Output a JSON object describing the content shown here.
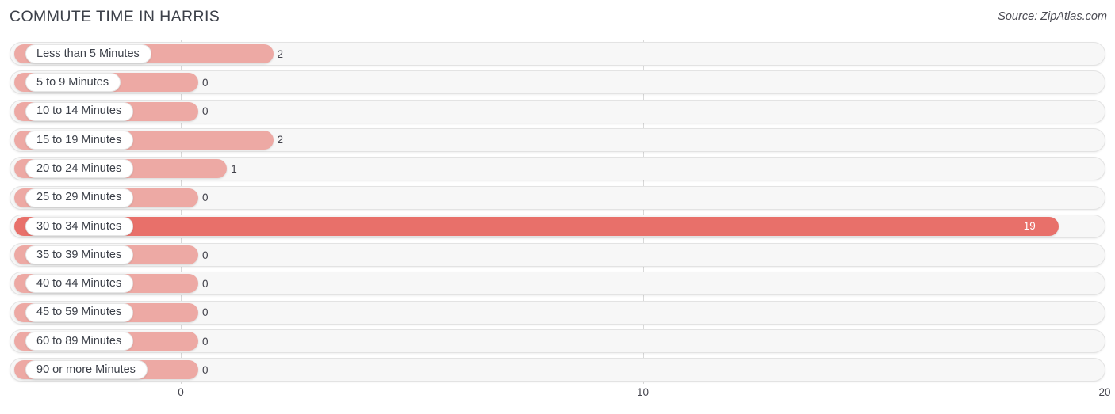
{
  "header": {
    "title": "COMMUTE TIME IN HARRIS",
    "source": "Source: ZipAtlas.com"
  },
  "colors": {
    "bar": "#eda9a4",
    "bar_highlight": "#e8706a",
    "track": "#f7f7f7",
    "track_border": "#e3e3e3",
    "gridline": "#d9d9d9",
    "text": "#3c4049",
    "value_in_bar": "#ffffff"
  },
  "chart_data": {
    "type": "bar",
    "orientation": "horizontal",
    "title": "COMMUTE TIME IN HARRIS",
    "subtitle": "Source: ZipAtlas.com",
    "xlabel": "",
    "ylabel": "",
    "xlim": [
      0,
      20
    ],
    "xticks": [
      0,
      10,
      20
    ],
    "xtick_labels": [
      "0",
      "10",
      "20"
    ],
    "grid": true,
    "legend": false,
    "categories": [
      "Less than 5 Minutes",
      "5 to 9 Minutes",
      "10 to 14 Minutes",
      "15 to 19 Minutes",
      "20 to 24 Minutes",
      "25 to 29 Minutes",
      "30 to 34 Minutes",
      "35 to 39 Minutes",
      "40 to 44 Minutes",
      "45 to 59 Minutes",
      "60 to 89 Minutes",
      "90 or more Minutes"
    ],
    "values": [
      2,
      0,
      0,
      2,
      1,
      0,
      19,
      0,
      0,
      0,
      0,
      0
    ],
    "value_labels": [
      "2",
      "0",
      "0",
      "2",
      "1",
      "0",
      "19",
      "0",
      "0",
      "0",
      "0",
      "0"
    ],
    "highlight_index": 6,
    "rows": [
      {
        "label": "Less than 5 Minutes",
        "value": 2,
        "value_label": "2",
        "highlight": false
      },
      {
        "label": "5 to 9 Minutes",
        "value": 0,
        "value_label": "0",
        "highlight": false
      },
      {
        "label": "10 to 14 Minutes",
        "value": 0,
        "value_label": "0",
        "highlight": false
      },
      {
        "label": "15 to 19 Minutes",
        "value": 2,
        "value_label": "2",
        "highlight": false
      },
      {
        "label": "20 to 24 Minutes",
        "value": 1,
        "value_label": "1",
        "highlight": false
      },
      {
        "label": "25 to 29 Minutes",
        "value": 0,
        "value_label": "0",
        "highlight": false
      },
      {
        "label": "30 to 34 Minutes",
        "value": 19,
        "value_label": "19",
        "highlight": true
      },
      {
        "label": "35 to 39 Minutes",
        "value": 0,
        "value_label": "0",
        "highlight": false
      },
      {
        "label": "40 to 44 Minutes",
        "value": 0,
        "value_label": "0",
        "highlight": false
      },
      {
        "label": "45 to 59 Minutes",
        "value": 0,
        "value_label": "0",
        "highlight": false
      },
      {
        "label": "60 to 89 Minutes",
        "value": 0,
        "value_label": "0",
        "highlight": false
      },
      {
        "label": "90 or more Minutes",
        "value": 0,
        "value_label": "0",
        "highlight": false
      }
    ]
  }
}
